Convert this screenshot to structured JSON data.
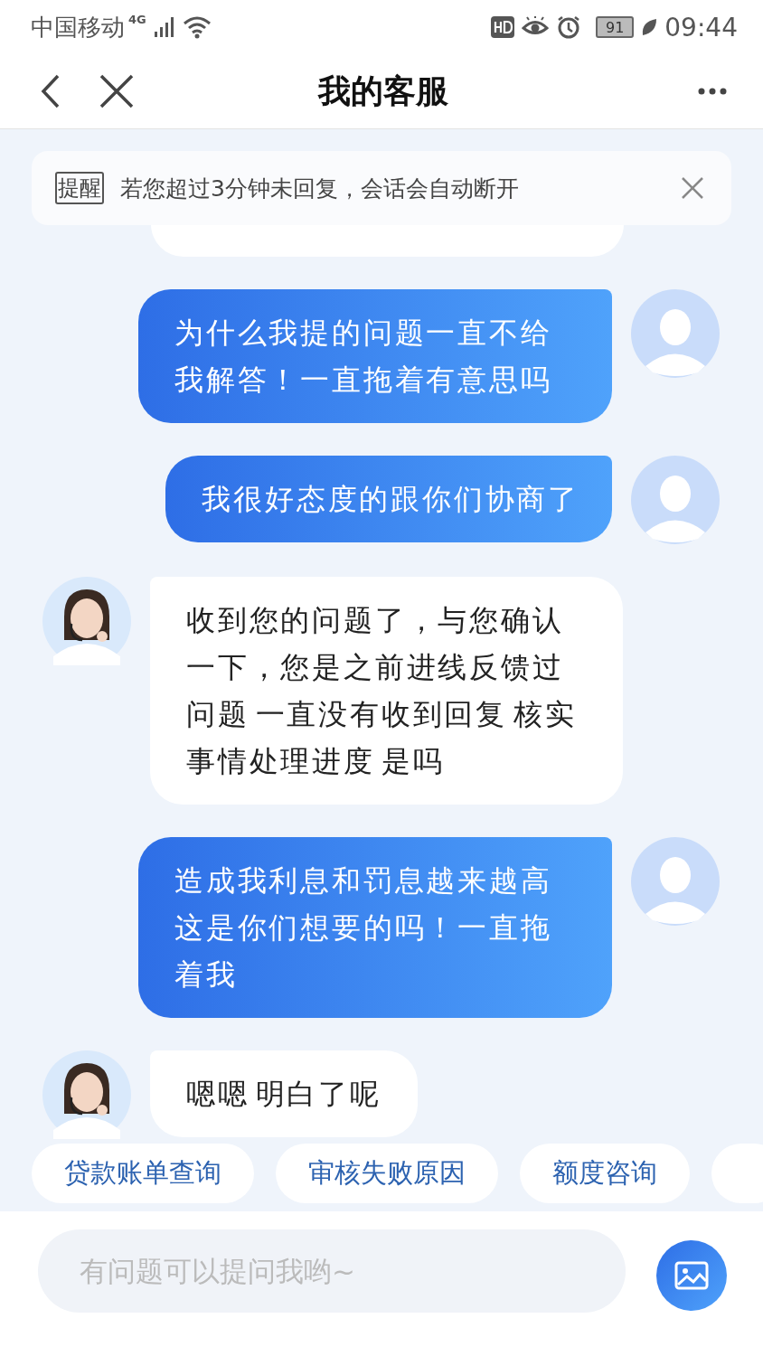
{
  "status_bar": {
    "carrier": "中国移动",
    "network": "4G",
    "battery": "91",
    "time": "09:44"
  },
  "header": {
    "title": "我的客服"
  },
  "notice": {
    "tag": "提醒",
    "text": "若您超过3分钟未回复，会话会自动断开"
  },
  "messages": [
    {
      "kind": "partial"
    },
    {
      "kind": "user",
      "text": "为什么我提的问题一直不给我解答！一直拖着有意思吗"
    },
    {
      "kind": "user",
      "text": "我很好态度的跟你们协商了"
    },
    {
      "kind": "agent",
      "text": "收到您的问题了，与您确认一下，您是之前进线反馈过问题 一直没有收到回复 核实事情处理进度 是吗"
    },
    {
      "kind": "user",
      "text": "造成我利息和罚息越来越高这是你们想要的吗！一直拖着我"
    },
    {
      "kind": "agent",
      "text": "嗯嗯 明白了呢"
    }
  ],
  "quick_replies": [
    "贷款账单查询",
    "审核失败原因",
    "额度咨询"
  ],
  "input": {
    "placeholder": "有问题可以提问我哟~"
  }
}
